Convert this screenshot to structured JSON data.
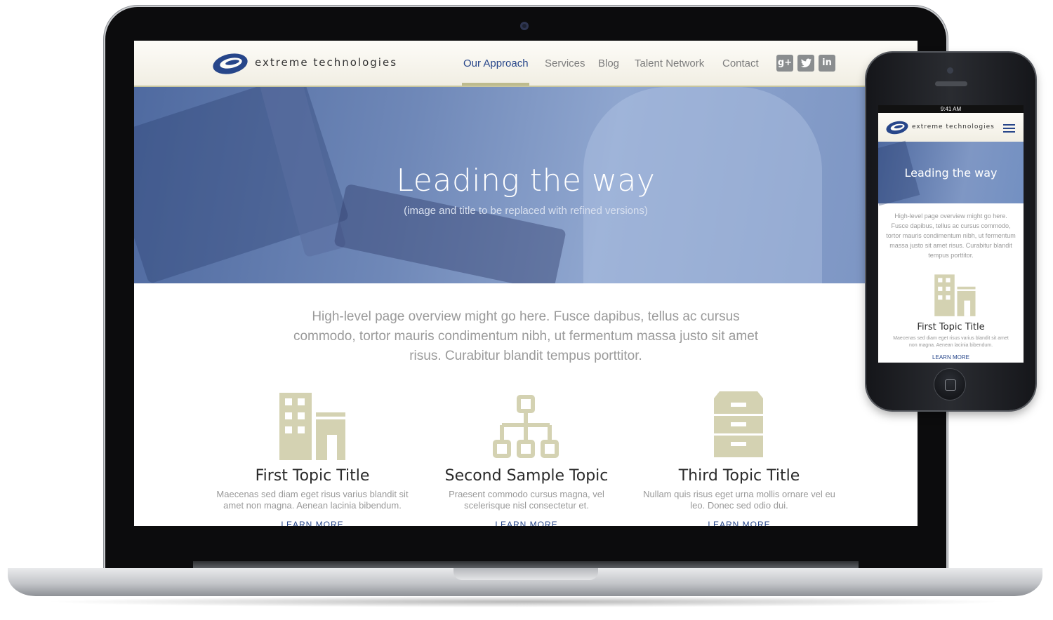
{
  "colors": {
    "brand_blue": "#27468a",
    "icon_khaki": "#d4d2b2",
    "hero_blue": "#6f88b8"
  },
  "site": {
    "logo_text": "extreme technologies",
    "nav": [
      {
        "label": "Our Approach",
        "active": true
      },
      {
        "label": "Services",
        "active": false
      },
      {
        "label": "Blog",
        "active": false
      },
      {
        "label": "Talent Network",
        "active": false
      },
      {
        "label": "Contact",
        "active": false
      }
    ],
    "social_icons": [
      "google-plus-icon",
      "twitter-icon",
      "linkedin-icon"
    ]
  },
  "hero": {
    "title": "Leading the way",
    "subtitle": "(image and title to be replaced with refined versions)"
  },
  "overview": "High-level page overview might go here. Fusce dapibus, tellus ac cursus commodo, tortor mauris condimentum nibh, ut fermentum massa justo sit amet risus. Curabitur blandit tempus porttitor.",
  "topics": [
    {
      "icon": "building-icon",
      "title": "First Topic Title",
      "text": "Maecenas sed diam eget risus varius blandit sit amet non magna. Aenean lacinia bibendum.",
      "link": "LEARN MORE"
    },
    {
      "icon": "org-chart-icon",
      "title": "Second Sample Topic",
      "text": "Praesent commodo cursus magna, vel scelerisque nisl consectetur et.",
      "link": "LEARN MORE"
    },
    {
      "icon": "file-cabinet-icon",
      "title": "Third Topic Title",
      "text": "Nullam quis risus eget urna mollis ornare vel eu leo. Donec sed odio dui.",
      "link": "LEARN MORE"
    }
  ],
  "phone": {
    "status_time": "9:41 AM",
    "logo_text": "extreme technologies",
    "hero_title": "Leading the way",
    "overview": "High-level page overview might go here. Fusce dapibus, tellus ac cursus commodo, tortor mauris condimentum nibh, ut fermentum massa justo sit amet risus. Curabitur blandit tempus porttitor.",
    "topic_title": "First Topic Title",
    "topic_text": "Maecenas sed diam eget risus varius blandit sit amet non magna. Aenean lacinia bibendum.",
    "topic_link": "LEARN MORE"
  }
}
